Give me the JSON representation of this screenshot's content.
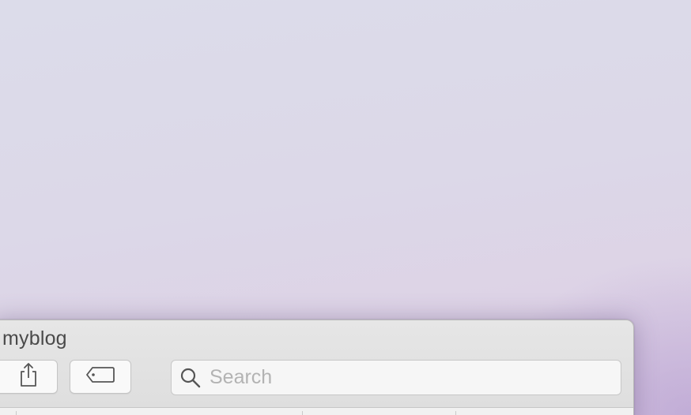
{
  "window": {
    "title": "myblog"
  },
  "toolbar": {
    "share_icon": "share-icon",
    "tags_icon": "tag-icon"
  },
  "search": {
    "placeholder": "Search",
    "value": "",
    "icon": "search-icon"
  },
  "colors": {
    "window_chrome": "#dedede",
    "button_bg": "#f9f9f9",
    "placeholder": "#b3b3b3",
    "title_text": "#4a4a4a"
  }
}
